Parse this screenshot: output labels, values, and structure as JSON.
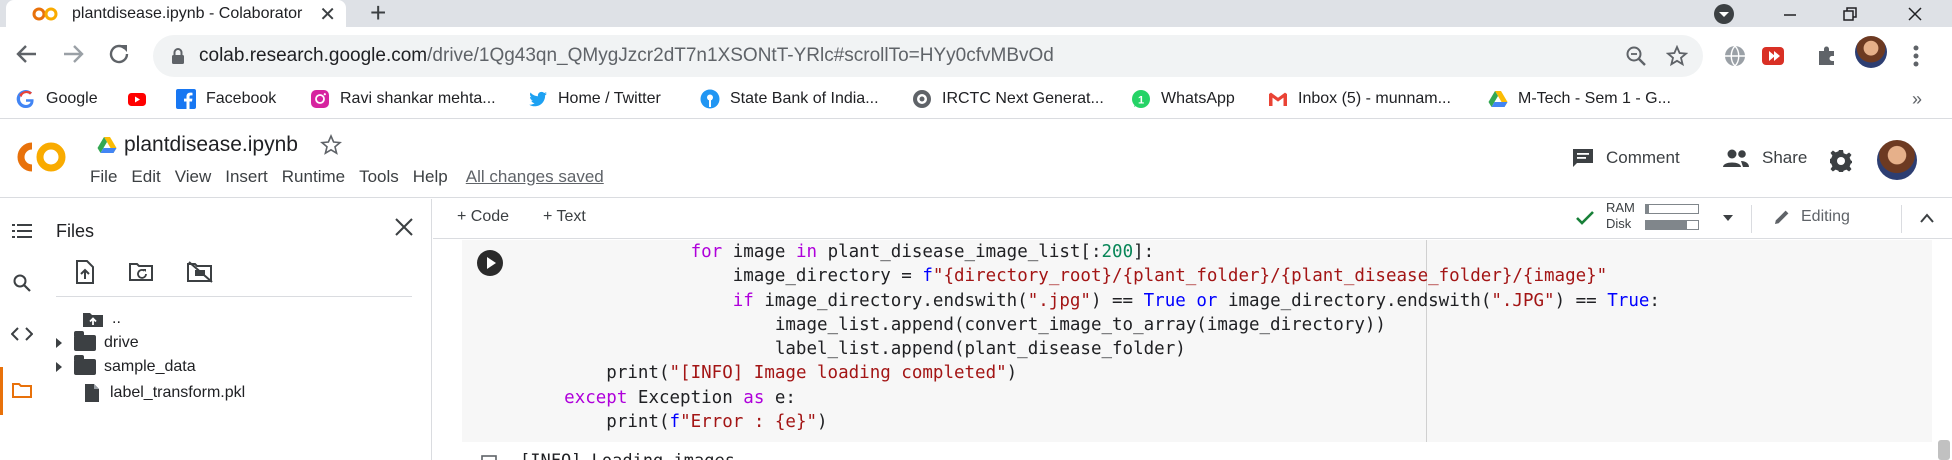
{
  "browser": {
    "tab_title": "plantdisease.ipynb - Colaborator",
    "tab_close": "✕",
    "new_tab": "+",
    "url_host": "colab.research.google.com",
    "url_path": "/drive/1Qg43qn_QMygJzcr2dT7n1XSONtT-YRlc#scrollTo=HYy0cfvMBvOd"
  },
  "bookmarks": [
    {
      "label": "Google",
      "icon": "google-icon"
    },
    {
      "label": "",
      "icon": "youtube-icon"
    },
    {
      "label": "Facebook",
      "icon": "facebook-icon"
    },
    {
      "label": "Ravi shankar mehta...",
      "icon": "instagram-icon"
    },
    {
      "label": "Home / Twitter",
      "icon": "twitter-icon"
    },
    {
      "label": "State Bank of India...",
      "icon": "sbi-icon"
    },
    {
      "label": "IRCTC Next Generat...",
      "icon": "irctc-icon"
    },
    {
      "label": "WhatsApp",
      "icon": "whatsapp-icon"
    },
    {
      "label": "Inbox (5) - munnam...",
      "icon": "gmail-icon"
    },
    {
      "label": "M-Tech - Sem 1 - G...",
      "icon": "drive-icon"
    }
  ],
  "bookmarks_more": "»",
  "colab": {
    "logo_text": "CO",
    "notebook_title": "plantdisease.ipynb",
    "menu": [
      "File",
      "Edit",
      "View",
      "Insert",
      "Runtime",
      "Tools",
      "Help"
    ],
    "save_status": "All changes saved",
    "comment_label": "Comment",
    "share_label": "Share"
  },
  "sidebar": {
    "title": "Files",
    "close": "✕",
    "items": [
      {
        "name": "..",
        "type": "parent"
      },
      {
        "name": "drive",
        "type": "folder"
      },
      {
        "name": "sample_data",
        "type": "folder"
      },
      {
        "name": "label_transform.pkl",
        "type": "file"
      }
    ]
  },
  "notebook_toolbar": {
    "add_code": "+ Code",
    "add_text": "+ Text",
    "ram_label": "RAM",
    "disk_label": "Disk",
    "ram_usage": 0.05,
    "disk_usage": 0.78,
    "editing_label": "Editing"
  },
  "cell": {
    "output_text": "[INFO] Loading images ..."
  },
  "colors": {
    "keyword": "#af00db",
    "builtin": "#0000ff",
    "string": "#a31515",
    "number": "#098658",
    "colab_orange": "#f9ab00",
    "check_green": "#188038"
  }
}
